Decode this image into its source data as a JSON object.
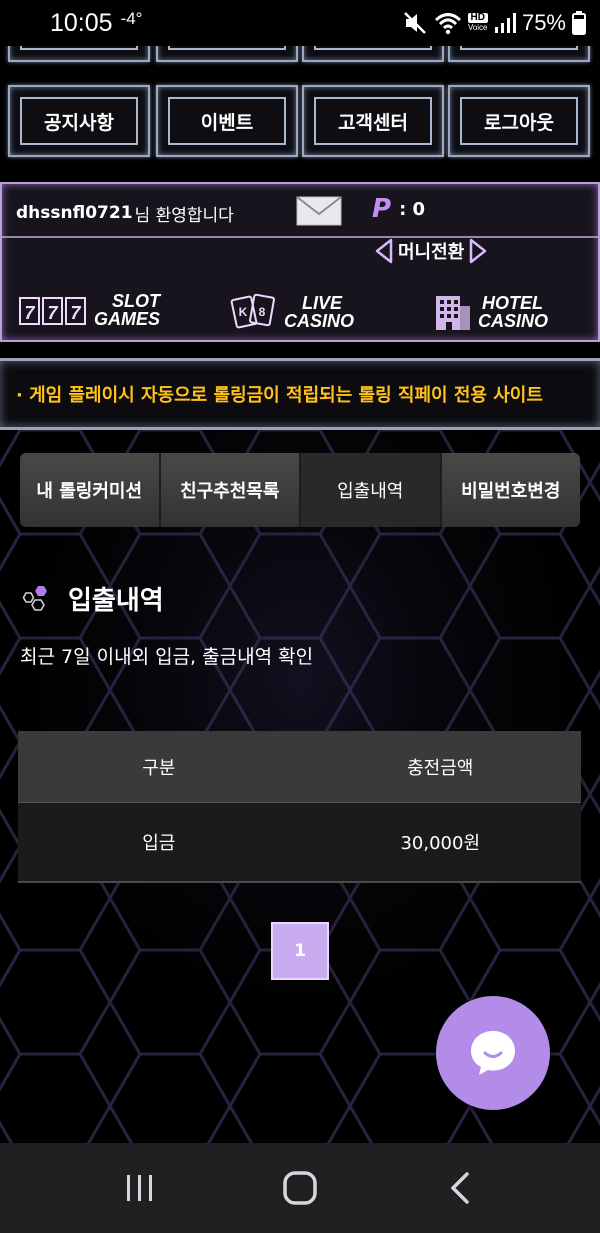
{
  "status_bar": {
    "time": "10:05",
    "temp": "-4°",
    "hd_badge": "HD",
    "voice_badge": "Voice",
    "battery": "75%"
  },
  "nav": {
    "top_row": [
      "",
      "",
      "",
      ""
    ],
    "bottom_row": [
      "공지사항",
      "이벤트",
      "고객센터",
      "로그아웃"
    ]
  },
  "user": {
    "id": "dhssnfl0721",
    "welcome": "님 환영합니다",
    "point_label": "P",
    "point_value": ": 0",
    "money_swap": "머니전환"
  },
  "games": [
    {
      "line1": "SLOT",
      "line2": "GAMES",
      "icon": "slot-777-icon"
    },
    {
      "line1": "LIVE",
      "line2": "CASINO",
      "icon": "cards-icon"
    },
    {
      "line1": "HOTEL",
      "line2": "CASINO",
      "icon": "hotel-building-icon"
    }
  ],
  "marquee": "· 게임 플레이시 자동으로 롤링금이 적립되는 롤링 직페이 전용 사이트",
  "tabs": [
    {
      "label": "내 롤링커미션",
      "active": false
    },
    {
      "label": "친구추천목록",
      "active": false
    },
    {
      "label": "입출내역",
      "active": true
    },
    {
      "label": "비밀번호변경",
      "active": false
    }
  ],
  "section": {
    "title": "입출내역",
    "description": "최근 7일 이내외 입금, 출금내역 확인"
  },
  "table": {
    "headers": [
      "구분",
      "충전금액"
    ],
    "rows": [
      [
        "입금",
        "30,000원"
      ]
    ]
  },
  "pagination": {
    "current": "1"
  },
  "colors": {
    "accent_purple": "#c9abf0",
    "marquee_text": "#ffc21a",
    "chat_fab": "#b28ce8"
  }
}
